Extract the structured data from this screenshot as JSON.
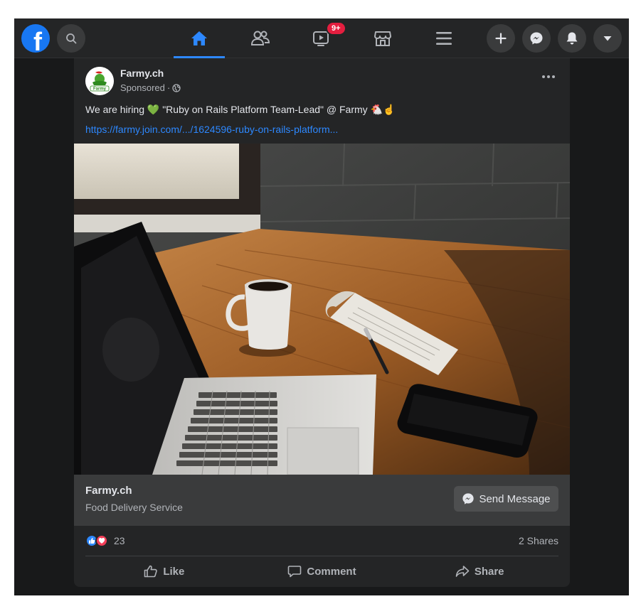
{
  "topbar": {
    "logo_letter": "f",
    "watch_badge": "9+"
  },
  "post": {
    "page_name": "Farmy.ch",
    "avatar_text": "Farmy",
    "sponsored": "Sponsored",
    "sponsored_sep": "·",
    "text": "We are hiring 💚 \"Ruby on Rails Platform Team-Lead\" @ Farmy 🐔☝",
    "link": "https://farmy.join.com/.../1624596-ruby-on-rails-platform...",
    "cta": {
      "title": "Farmy.ch",
      "subtitle": "Food Delivery Service",
      "button_label": "Send Message"
    },
    "stats": {
      "reactions_count": "23",
      "shares": "2 Shares"
    },
    "actions": {
      "like": "Like",
      "comment": "Comment",
      "share": "Share"
    }
  },
  "colors": {
    "accent": "#2d88ff",
    "brand": "#1877f2",
    "badge": "#e41e3f",
    "background": "#18191a",
    "surface": "#242526"
  }
}
